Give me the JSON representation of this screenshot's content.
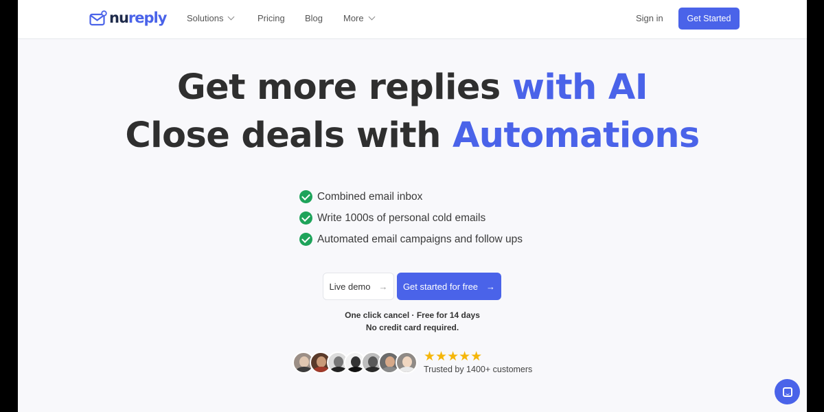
{
  "brand": {
    "logo_part1": "nu",
    "logo_part2": "reply",
    "accent": "#4a63e9"
  },
  "nav": {
    "items": [
      {
        "label": "Solutions",
        "has_dropdown": true
      },
      {
        "label": "Pricing",
        "has_dropdown": false
      },
      {
        "label": "Blog",
        "has_dropdown": false
      },
      {
        "label": "More",
        "has_dropdown": true
      }
    ],
    "signin": "Sign in",
    "cta": "Get Started"
  },
  "hero": {
    "line1_main": "Get more replies ",
    "line1_accent": "with AI",
    "line2_main": "Close deals with ",
    "line2_accent": "Automations"
  },
  "features": [
    "Combined email inbox",
    "Write 1000s of personal cold emails",
    "Automated email campaigns and follow ups"
  ],
  "buttons": {
    "demo": "Live demo",
    "demo_arrow": "→",
    "free": "Get started for free",
    "free_arrow": "→"
  },
  "notes": {
    "line1": "One click cancel · Free for 14 days",
    "line2": "No credit card required."
  },
  "social_proof": {
    "avatar_count": 7,
    "stars": "★★★★★",
    "rating": 5,
    "trusted": "Trusted by 1400+ customers"
  },
  "icons": {
    "check": "check-circle-icon",
    "chat": "chat-bubble-icon",
    "logo": "envelope-logo-icon"
  }
}
